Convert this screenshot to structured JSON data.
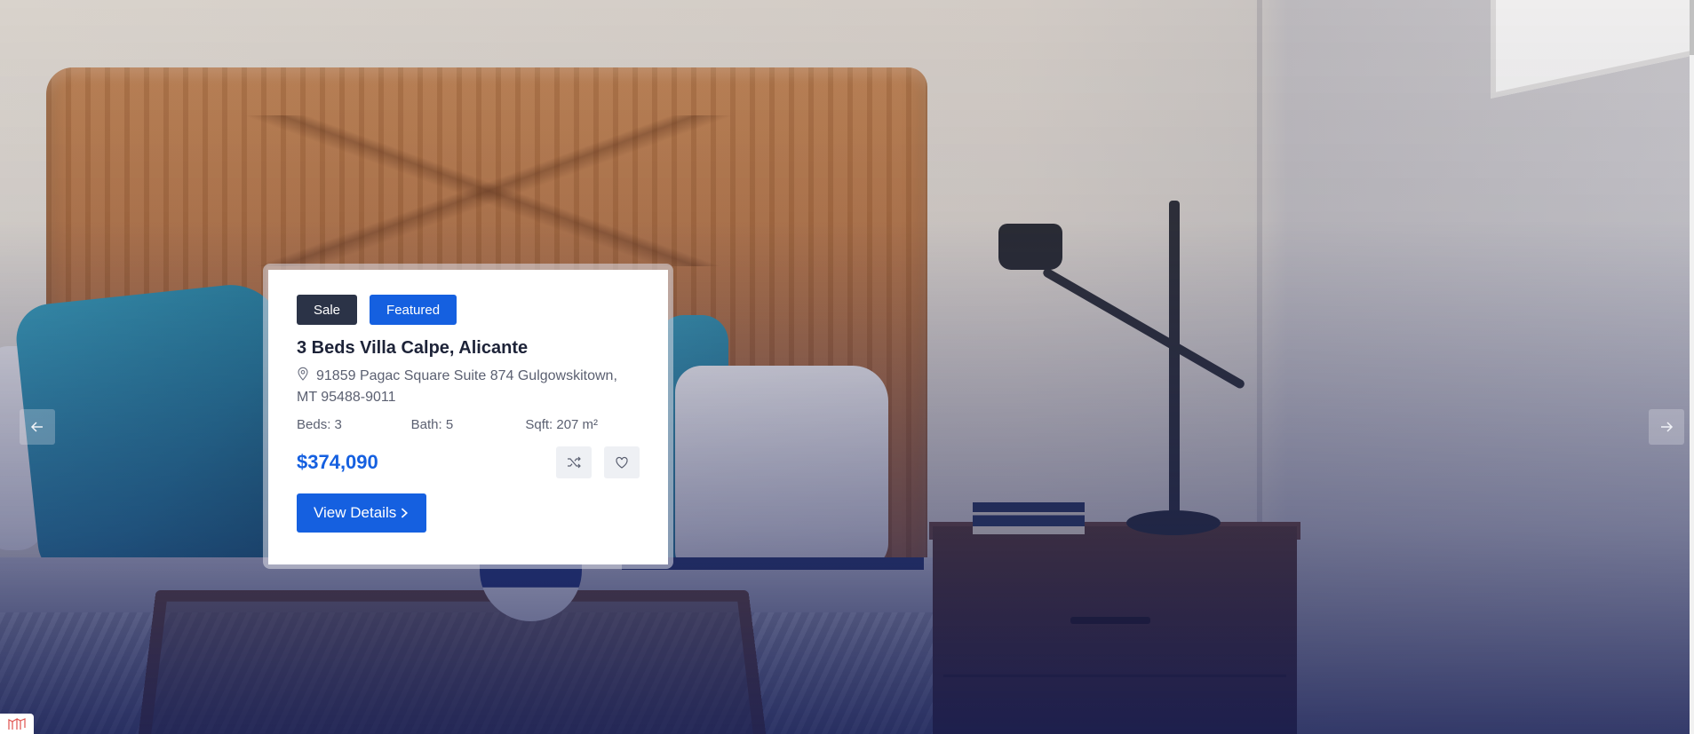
{
  "slider": {
    "prev_icon": "arrow-left-icon",
    "next_icon": "arrow-right-icon"
  },
  "property": {
    "badges": [
      "Sale",
      "Featured"
    ],
    "title": "3 Beds Villa Calpe, Alicante",
    "address_icon": "map-pin-icon",
    "address": "91859 Pagac Square Suite 874 Gulgowskitown, MT 95488-9011",
    "beds": "Beds: 3",
    "bath": "Bath: 5",
    "sqft": "Sqft: 207 m²",
    "price": "$374,090",
    "compare_icon": "shuffle-icon",
    "favorite_icon": "heart-icon",
    "view_details_label": "View Details"
  },
  "colors": {
    "accent": "#1560e0",
    "badge_sale": "#2b3347",
    "title": "#1d2338",
    "muted_text": "#5b6071"
  },
  "corner_logo_icon": "brand-logo-icon"
}
